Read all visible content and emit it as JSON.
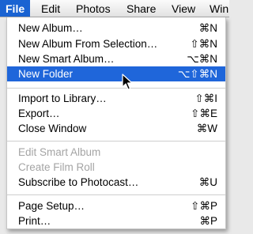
{
  "menubar": {
    "items": [
      "File",
      "Edit",
      "Photos",
      "Share",
      "View",
      "Win"
    ],
    "active_index": 0
  },
  "menu": {
    "items": [
      {
        "label": "New Album…",
        "shortcut": "⌘N"
      },
      {
        "label": "New Album From Selection…",
        "shortcut": "⇧⌘N"
      },
      {
        "label": "New Smart Album…",
        "shortcut": "⌥⌘N"
      },
      {
        "label": "New Folder",
        "shortcut": "⌥⇧⌘N"
      },
      {
        "label": "Import to Library…",
        "shortcut": "⇧⌘I"
      },
      {
        "label": "Export…",
        "shortcut": "⇧⌘E"
      },
      {
        "label": "Close Window",
        "shortcut": "⌘W"
      },
      {
        "label": "Edit Smart Album",
        "shortcut": ""
      },
      {
        "label": "Create Film Roll",
        "shortcut": ""
      },
      {
        "label": "Subscribe to Photocast…",
        "shortcut": "⌘U"
      },
      {
        "label": "Page Setup…",
        "shortcut": "⇧⌘P"
      },
      {
        "label": "Print…",
        "shortcut": "⌘P"
      }
    ],
    "highlighted_index": 3,
    "disabled_indices": [
      7,
      8
    ]
  },
  "colors": {
    "highlight": "#1f66da",
    "disabled_text": "#a4a4a4"
  },
  "icons": {
    "pointer": "arrow-cursor-icon"
  }
}
